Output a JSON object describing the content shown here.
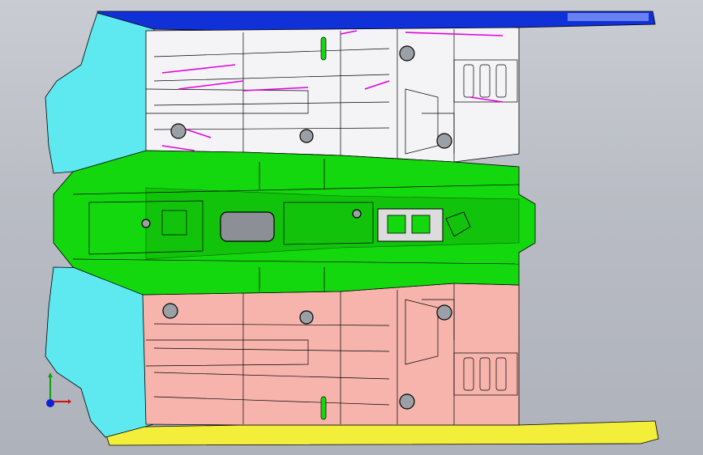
{
  "viewport": {
    "background_top": "#c9ccd3",
    "background_bottom": "#aeb2bb"
  },
  "parts": [
    {
      "id": "left-rocker-sill",
      "color": "#1030d8"
    },
    {
      "id": "right-rocker-sill",
      "color": "#f2ee3a"
    },
    {
      "id": "front-floor-crossmember",
      "color": "#5ee8f0"
    },
    {
      "id": "center-tunnel",
      "color": "#14d80e"
    },
    {
      "id": "left-floor-panel",
      "color": "#f4f4f6"
    },
    {
      "id": "right-floor-panel",
      "color": "#f6b4ac"
    },
    {
      "id": "rear-crossmember-left",
      "color": "#e4e4ea"
    },
    {
      "id": "rear-crossmember-right",
      "color": "#f0c2bc"
    }
  ],
  "interference_color": "#e000e0",
  "triad": {
    "x_color": "#d01010",
    "y_color": "#10a010",
    "z_color": "#1020d0",
    "icon": "coordinate-triad-icon"
  }
}
